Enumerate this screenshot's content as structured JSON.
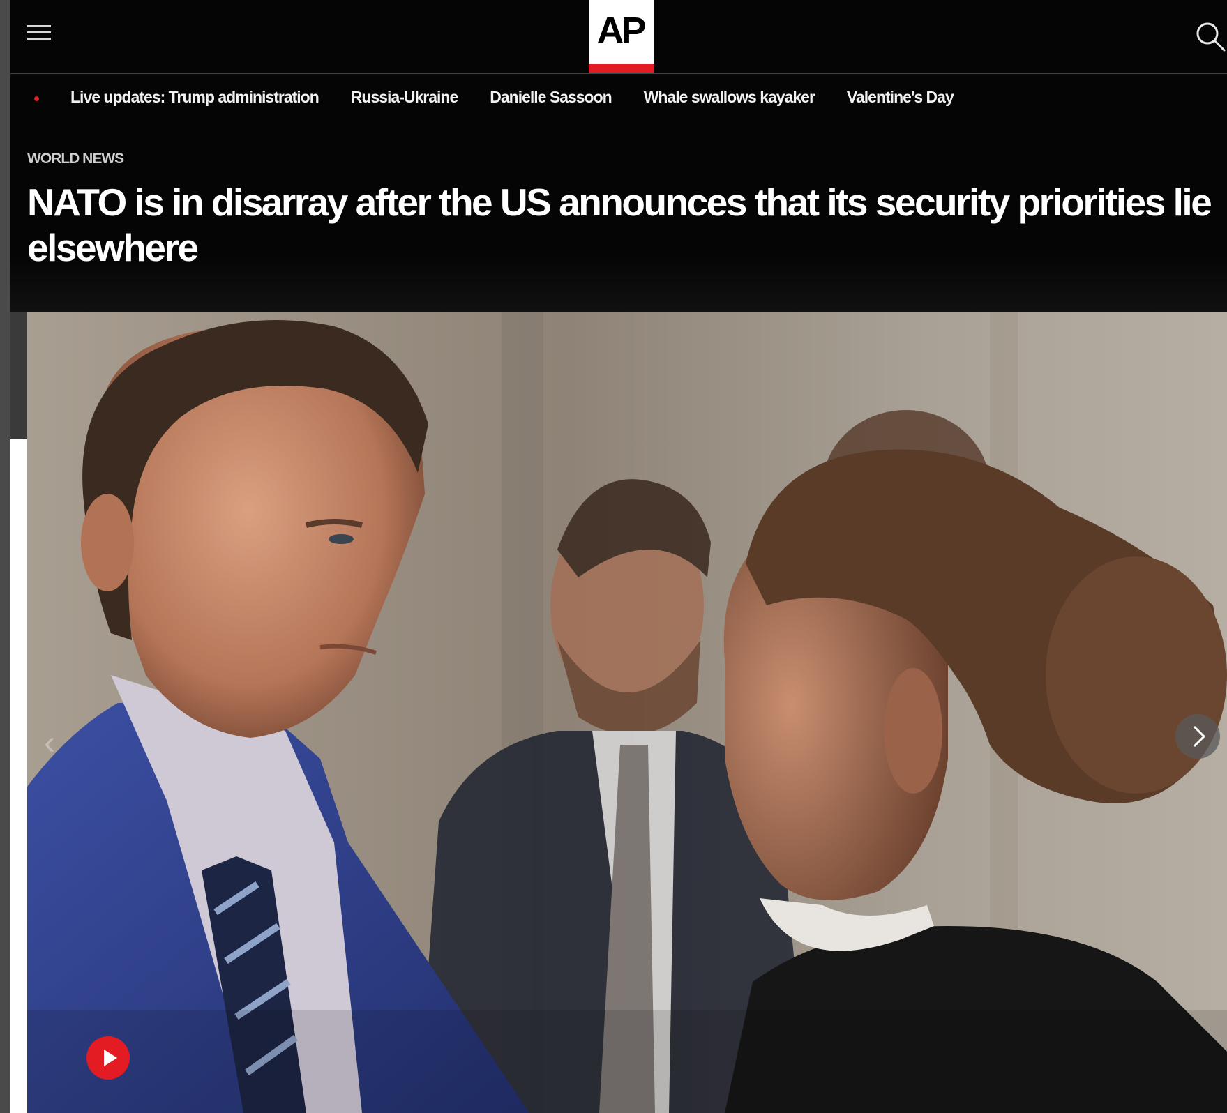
{
  "header": {
    "logo_text": "AP",
    "menu_icon": "hamburger-menu-icon",
    "search_icon": "search-icon",
    "accent_color": "#e31b23"
  },
  "trending": {
    "items": [
      "Live updates: Trump administration",
      "Russia-Ukraine",
      "Danielle Sassoon",
      "Whale swallows kayaker",
      "Valentine's Day"
    ]
  },
  "article": {
    "section": "WORLD NEWS",
    "headline": "NATO is in disarray after the US announces that its security priorities lie elsewhere"
  },
  "gallery": {
    "prev_icon": "chevron-left-icon",
    "next_icon": "chevron-right-icon",
    "play_icon": "play-icon"
  }
}
